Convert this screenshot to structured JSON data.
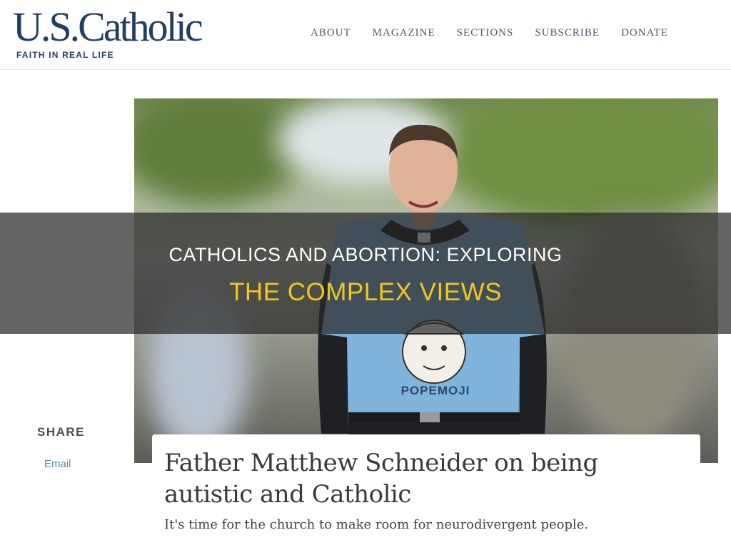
{
  "header": {
    "logo_text": "U.S.Catholic",
    "tagline": "FAITH IN REAL LIFE",
    "nav": [
      "ABOUT",
      "MAGAZINE",
      "SECTIONS",
      "SUBSCRIBE",
      "DONATE"
    ]
  },
  "hero": {
    "shirt_text": "POPEMOJI"
  },
  "banner": {
    "line1": "CATHOLICS AND ABORTION: EXPLORING",
    "line2": "THE COMPLEX VIEWS",
    "line2_color": "#f5c518"
  },
  "share": {
    "title": "SHARE",
    "email": "Email"
  },
  "article": {
    "title": "Father Matthew Schneider on being autistic and Catholic",
    "subtitle": "It's time for the church to make room for neurodivergent people."
  },
  "colors": {
    "brand": "#243f5e",
    "link": "#5b87a8"
  }
}
